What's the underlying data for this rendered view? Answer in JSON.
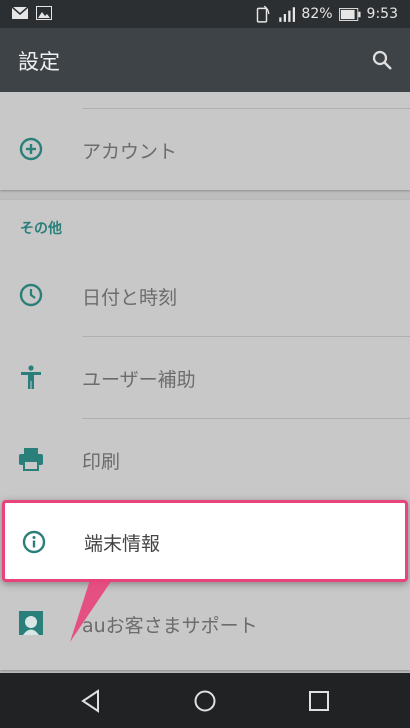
{
  "status_bar": {
    "battery": "82%",
    "time": "9:53"
  },
  "app_bar": {
    "title": "設定"
  },
  "colors": {
    "accent": "#2a7f7a",
    "highlight_border": "#e8437b",
    "app_bar": "#3e4347"
  },
  "list": {
    "account": {
      "label": "アカウント",
      "icon": "add-circle-icon"
    },
    "section_other": "その他",
    "items": [
      {
        "label": "日付と時刻",
        "icon": "clock-icon"
      },
      {
        "label": "ユーザー補助",
        "icon": "accessibility-icon"
      },
      {
        "label": "印刷",
        "icon": "printer-icon"
      },
      {
        "label": "端末情報",
        "icon": "info-icon"
      },
      {
        "label": "auお客さまサポート",
        "icon": "au-support-icon"
      }
    ]
  },
  "nav": {
    "back": "back-icon",
    "home": "home-icon",
    "recents": "recents-icon"
  }
}
